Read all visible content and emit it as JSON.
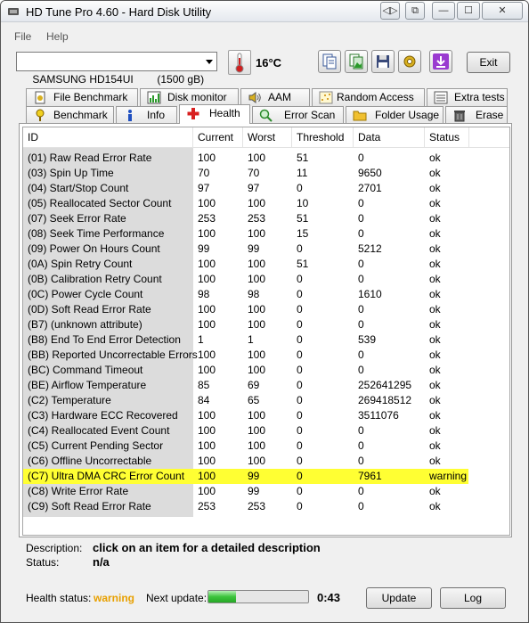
{
  "window": {
    "title": "HD Tune Pro 4.60 - Hard Disk Utility",
    "controls": {
      "restore_label": "◁▷",
      "pin_label": "⧉",
      "minimize_label": "—",
      "maximize_label": "☐",
      "close_label": "✕"
    }
  },
  "menu": {
    "file": "File",
    "help": "Help"
  },
  "toolbar": {
    "drive": "SAMSUNG HD154UI        (1500 gB)",
    "temperature": "16°C",
    "exit_label": "Exit",
    "icons": [
      "copy-info-icon",
      "copy-screenshot-icon",
      "save-icon",
      "options-icon",
      "download-icon"
    ]
  },
  "tabs": {
    "row1": [
      "File Benchmark",
      "Disk monitor",
      "AAM",
      "Random Access",
      "Extra tests"
    ],
    "row2": [
      "Benchmark",
      "Info",
      "Health",
      "Error Scan",
      "Folder Usage",
      "Erase"
    ],
    "active": "Health"
  },
  "table": {
    "columns": [
      "ID",
      "Current",
      "Worst",
      "Threshold",
      "Data",
      "Status"
    ],
    "rows": [
      [
        "(01) Raw Read Error Rate",
        "100",
        "100",
        "51",
        "0",
        "ok"
      ],
      [
        "(03) Spin Up Time",
        "70",
        "70",
        "11",
        "9650",
        "ok"
      ],
      [
        "(04) Start/Stop Count",
        "97",
        "97",
        "0",
        "2701",
        "ok"
      ],
      [
        "(05) Reallocated Sector Count",
        "100",
        "100",
        "10",
        "0",
        "ok"
      ],
      [
        "(07) Seek Error Rate",
        "253",
        "253",
        "51",
        "0",
        "ok"
      ],
      [
        "(08) Seek Time Performance",
        "100",
        "100",
        "15",
        "0",
        "ok"
      ],
      [
        "(09) Power On Hours Count",
        "99",
        "99",
        "0",
        "5212",
        "ok"
      ],
      [
        "(0A) Spin Retry Count",
        "100",
        "100",
        "51",
        "0",
        "ok"
      ],
      [
        "(0B) Calibration Retry Count",
        "100",
        "100",
        "0",
        "0",
        "ok"
      ],
      [
        "(0C) Power Cycle Count",
        "98",
        "98",
        "0",
        "1610",
        "ok"
      ],
      [
        "(0D) Soft Read Error Rate",
        "100",
        "100",
        "0",
        "0",
        "ok"
      ],
      [
        "(B7) (unknown attribute)",
        "100",
        "100",
        "0",
        "0",
        "ok"
      ],
      [
        "(B8) End To End Error Detection",
        "1",
        "1",
        "0",
        "539",
        "ok"
      ],
      [
        "(BB) Reported Uncorrectable Errors",
        "100",
        "100",
        "0",
        "0",
        "ok"
      ],
      [
        "(BC) Command Timeout",
        "100",
        "100",
        "0",
        "0",
        "ok"
      ],
      [
        "(BE) Airflow Temperature",
        "85",
        "69",
        "0",
        "252641295",
        "ok"
      ],
      [
        "(C2) Temperature",
        "84",
        "65",
        "0",
        "269418512",
        "ok"
      ],
      [
        "(C3) Hardware ECC Recovered",
        "100",
        "100",
        "0",
        "3511076",
        "ok"
      ],
      [
        "(C4) Reallocated Event Count",
        "100",
        "100",
        "0",
        "0",
        "ok"
      ],
      [
        "(C5) Current Pending Sector",
        "100",
        "100",
        "0",
        "0",
        "ok"
      ],
      [
        "(C6) Offline Uncorrectable",
        "100",
        "100",
        "0",
        "0",
        "ok"
      ],
      [
        "(C7) Ultra DMA CRC Error Count",
        "100",
        "99",
        "0",
        "7961",
        "warning"
      ],
      [
        "(C8) Write Error Rate",
        "100",
        "99",
        "0",
        "0",
        "ok"
      ],
      [
        "(C9) Soft Read Error Rate",
        "253",
        "253",
        "0",
        "0",
        "ok"
      ]
    ],
    "highlight_row": 21,
    "highlight_color": "#ffff33"
  },
  "details": {
    "description_label": "Description:",
    "description_value": "click on an item for a detailed description",
    "status_label": "Status:",
    "status_value": "n/a"
  },
  "statusbar": {
    "health_label": "Health status:",
    "health_value": "warning",
    "health_color": "#e8a000",
    "next_update_label": "Next update:",
    "progress_fraction": 0.28,
    "countdown": "0:43",
    "update_label": "Update",
    "log_label": "Log"
  }
}
